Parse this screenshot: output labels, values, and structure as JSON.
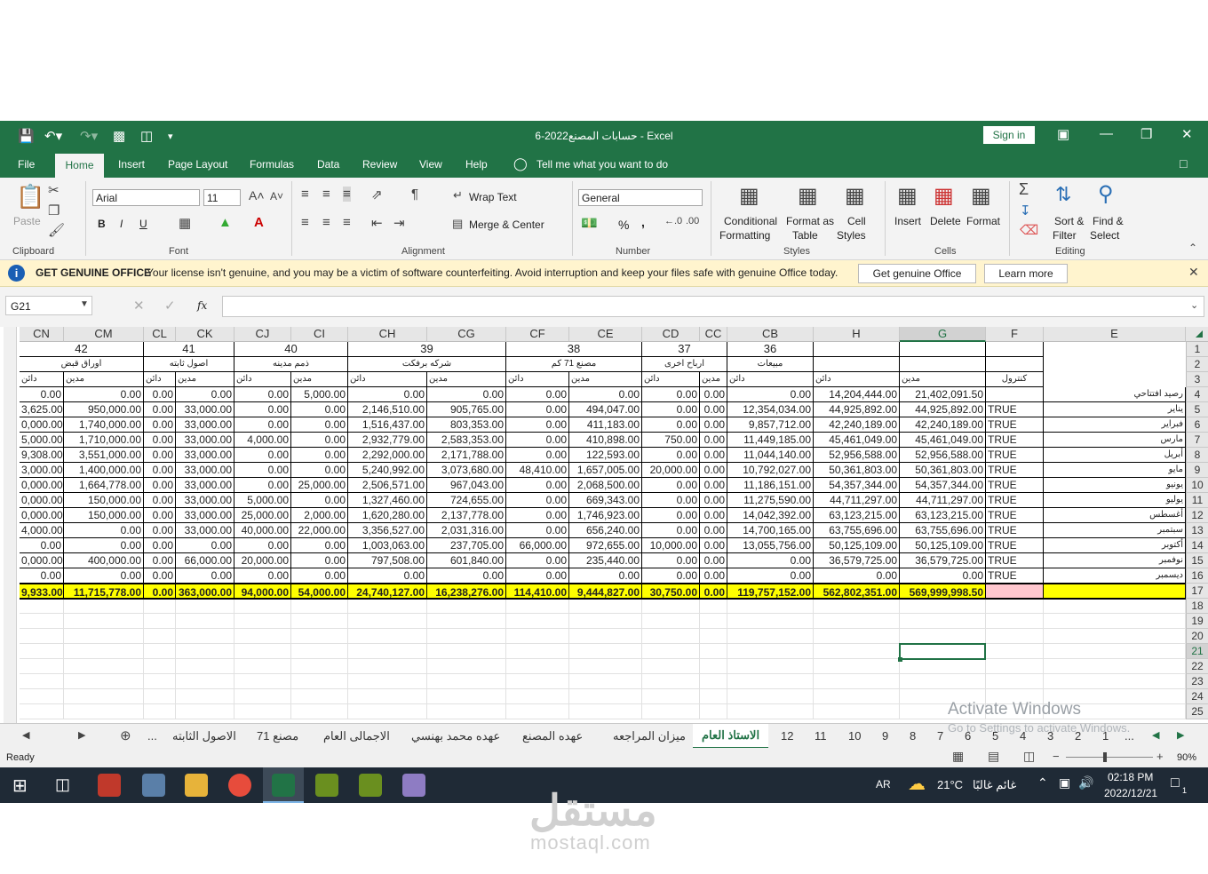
{
  "app": {
    "title": "حسابات المصنع2022-6  -  Excel",
    "sign_in": "Sign in"
  },
  "ribbon_tabs": [
    "File",
    "Home",
    "Insert",
    "Page Layout",
    "Formulas",
    "Data",
    "Review",
    "View",
    "Help"
  ],
  "tell_me": "Tell me what you want to do",
  "ribbon": {
    "clipboard": {
      "label": "Clipboard",
      "paste": "Paste"
    },
    "font": {
      "label": "Font",
      "name": "Arial",
      "size": "11",
      "bold": "B",
      "italic": "I",
      "underline": "U"
    },
    "alignment": {
      "label": "Alignment",
      "wrap": "Wrap Text",
      "merge": "Merge & Center"
    },
    "number": {
      "label": "Number",
      "format": "General",
      "percent": "%",
      "comma": ","
    },
    "styles": {
      "label": "Styles",
      "conditional": "Conditional",
      "formatting": "Formatting",
      "format_as": "Format as",
      "table": "Table",
      "cell": "Cell",
      "cell_styles": "Styles"
    },
    "cells": {
      "label": "Cells",
      "insert": "Insert",
      "delete": "Delete",
      "format": "Format"
    },
    "editing": {
      "label": "Editing",
      "sort": "Sort &",
      "filter": "Filter",
      "find": "Find &",
      "select": "Select"
    }
  },
  "license": {
    "title": "GET GENUINE OFFICE",
    "message": "Your license isn't genuine, and you may be a victim of software counterfeiting. Avoid interruption and keep your files safe with genuine Office today.",
    "button1": "Get genuine Office",
    "button2": "Learn more"
  },
  "formula_bar": {
    "name_box": "G21",
    "fx": "fx",
    "value": ""
  },
  "columns": [
    "CN",
    "CM",
    "CL",
    "CK",
    "CJ",
    "CI",
    "CH",
    "CG",
    "CF",
    "CE",
    "CD",
    "CC",
    "CB",
    "H",
    "G",
    "F",
    "E"
  ],
  "row_numbers": [
    "1",
    "2",
    "3",
    "4",
    "5",
    "6",
    "7",
    "8",
    "9",
    "10",
    "11",
    "12",
    "13",
    "14",
    "15",
    "16",
    "17",
    "18",
    "19",
    "20",
    "21",
    "22",
    "23",
    "24",
    "25"
  ],
  "sheet": {
    "group_numbers": [
      "42",
      "41",
      "40",
      "39",
      "38",
      "37",
      "36"
    ],
    "group_names": [
      "اوراق قبض",
      "اصول ثابته",
      "ذمم مدينه",
      "شركه برفكت",
      "مصنع 71 كم",
      "ارباح اخرى",
      "مبيعات"
    ],
    "dain": "دائن",
    "madin": "مدين",
    "control": "كنترول",
    "rows": [
      {
        "CN": "0.00",
        "CM": "0.00",
        "CL": "0.00",
        "CK": "0.00",
        "CJ": "0.00",
        "CI": "5,000.00",
        "CH": "0.00",
        "CG": "0.00",
        "CF": "0.00",
        "CE": "0.00",
        "CD": "0.00",
        "CC": "0.00",
        "CB": "0.00",
        "H": "14,204,444.00",
        "G": "21,402,091.50",
        "F": "",
        "E": "رصيد افتتاحي"
      },
      {
        "CN": "3,625.00",
        "CM": "950,000.00",
        "CL": "0.00",
        "CK": "33,000.00",
        "CJ": "0.00",
        "CI": "0.00",
        "CH": "2,146,510.00",
        "CG": "905,765.00",
        "CF": "0.00",
        "CE": "494,047.00",
        "CD": "0.00",
        "CC": "0.00",
        "CB": "12,354,034.00",
        "H": "44,925,892.00",
        "G": "44,925,892.00",
        "F": "TRUE",
        "E": "يناير"
      },
      {
        "CN": "0,000.00",
        "CM": "1,740,000.00",
        "CL": "0.00",
        "CK": "33,000.00",
        "CJ": "0.00",
        "CI": "0.00",
        "CH": "1,516,437.00",
        "CG": "803,353.00",
        "CF": "0.00",
        "CE": "411,183.00",
        "CD": "0.00",
        "CC": "0.00",
        "CB": "9,857,712.00",
        "H": "42,240,189.00",
        "G": "42,240,189.00",
        "F": "TRUE",
        "E": "فبراير"
      },
      {
        "CN": "5,000.00",
        "CM": "1,710,000.00",
        "CL": "0.00",
        "CK": "33,000.00",
        "CJ": "4,000.00",
        "CI": "0.00",
        "CH": "2,932,779.00",
        "CG": "2,583,353.00",
        "CF": "0.00",
        "CE": "410,898.00",
        "CD": "750.00",
        "CC": "0.00",
        "CB": "11,449,185.00",
        "H": "45,461,049.00",
        "G": "45,461,049.00",
        "F": "TRUE",
        "E": "مارس"
      },
      {
        "CN": "9,308.00",
        "CM": "3,551,000.00",
        "CL": "0.00",
        "CK": "33,000.00",
        "CJ": "0.00",
        "CI": "0.00",
        "CH": "2,292,000.00",
        "CG": "2,171,788.00",
        "CF": "0.00",
        "CE": "122,593.00",
        "CD": "0.00",
        "CC": "0.00",
        "CB": "11,044,140.00",
        "H": "52,956,588.00",
        "G": "52,956,588.00",
        "F": "TRUE",
        "E": "أبريل"
      },
      {
        "CN": "3,000.00",
        "CM": "1,400,000.00",
        "CL": "0.00",
        "CK": "33,000.00",
        "CJ": "0.00",
        "CI": "0.00",
        "CH": "5,240,992.00",
        "CG": "3,073,680.00",
        "CF": "48,410.00",
        "CE": "1,657,005.00",
        "CD": "20,000.00",
        "CC": "0.00",
        "CB": "10,792,027.00",
        "H": "50,361,803.00",
        "G": "50,361,803.00",
        "F": "TRUE",
        "E": "مايو"
      },
      {
        "CN": "0,000.00",
        "CM": "1,664,778.00",
        "CL": "0.00",
        "CK": "33,000.00",
        "CJ": "0.00",
        "CI": "25,000.00",
        "CH": "2,506,571.00",
        "CG": "967,043.00",
        "CF": "0.00",
        "CE": "2,068,500.00",
        "CD": "0.00",
        "CC": "0.00",
        "CB": "11,186,151.00",
        "H": "54,357,344.00",
        "G": "54,357,344.00",
        "F": "TRUE",
        "E": "يونيو"
      },
      {
        "CN": "0,000.00",
        "CM": "150,000.00",
        "CL": "0.00",
        "CK": "33,000.00",
        "CJ": "5,000.00",
        "CI": "0.00",
        "CH": "1,327,460.00",
        "CG": "724,655.00",
        "CF": "0.00",
        "CE": "669,343.00",
        "CD": "0.00",
        "CC": "0.00",
        "CB": "11,275,590.00",
        "H": "44,711,297.00",
        "G": "44,711,297.00",
        "F": "TRUE",
        "E": "يوليو"
      },
      {
        "CN": "0,000.00",
        "CM": "150,000.00",
        "CL": "0.00",
        "CK": "33,000.00",
        "CJ": "25,000.00",
        "CI": "2,000.00",
        "CH": "1,620,280.00",
        "CG": "2,137,778.00",
        "CF": "0.00",
        "CE": "1,746,923.00",
        "CD": "0.00",
        "CC": "0.00",
        "CB": "14,042,392.00",
        "H": "63,123,215.00",
        "G": "63,123,215.00",
        "F": "TRUE",
        "E": "أغسطس"
      },
      {
        "CN": "4,000.00",
        "CM": "0.00",
        "CL": "0.00",
        "CK": "33,000.00",
        "CJ": "40,000.00",
        "CI": "22,000.00",
        "CH": "3,356,527.00",
        "CG": "2,031,316.00",
        "CF": "0.00",
        "CE": "656,240.00",
        "CD": "0.00",
        "CC": "0.00",
        "CB": "14,700,165.00",
        "H": "63,755,696.00",
        "G": "63,755,696.00",
        "F": "TRUE",
        "E": "سبتمبر"
      },
      {
        "CN": "0.00",
        "CM": "0.00",
        "CL": "0.00",
        "CK": "0.00",
        "CJ": "0.00",
        "CI": "0.00",
        "CH": "1,003,063.00",
        "CG": "237,705.00",
        "CF": "66,000.00",
        "CE": "972,655.00",
        "CD": "10,000.00",
        "CC": "0.00",
        "CB": "13,055,756.00",
        "H": "50,125,109.00",
        "G": "50,125,109.00",
        "F": "TRUE",
        "E": "أكتوبر"
      },
      {
        "CN": "0,000.00",
        "CM": "400,000.00",
        "CL": "0.00",
        "CK": "66,000.00",
        "CJ": "20,000.00",
        "CI": "0.00",
        "CH": "797,508.00",
        "CG": "601,840.00",
        "CF": "0.00",
        "CE": "235,440.00",
        "CD": "0.00",
        "CC": "0.00",
        "CB": "0.00",
        "H": "36,579,725.00",
        "G": "36,579,725.00",
        "F": "TRUE",
        "E": "نوفمبر"
      },
      {
        "CN": "0.00",
        "CM": "0.00",
        "CL": "0.00",
        "CK": "0.00",
        "CJ": "0.00",
        "CI": "0.00",
        "CH": "0.00",
        "CG": "0.00",
        "CF": "0.00",
        "CE": "0.00",
        "CD": "0.00",
        "CC": "0.00",
        "CB": "0.00",
        "H": "0.00",
        "G": "0.00",
        "F": "TRUE",
        "E": "ديسمبر"
      }
    ],
    "totals": {
      "CN": "9,933.00",
      "CM": "11,715,778.00",
      "CL": "0.00",
      "CK": "363,000.00",
      "CJ": "94,000.00",
      "CI": "54,000.00",
      "CH": "24,740,127.00",
      "CG": "16,238,276.00",
      "CF": "114,410.00",
      "CE": "9,444,827.00",
      "CD": "30,750.00",
      "CC": "0.00",
      "CB": "119,757,152.00",
      "H": "562,802,351.00",
      "G": "569,999,998.50",
      "F": "",
      "E": ""
    }
  },
  "sheet_tabs_left": [
    "الاصول الثابته",
    "مصنع 71",
    "الاجمالى العام",
    "عهده محمد بهنسي",
    "عهده المصنع",
    "ميزان المراجعه",
    "الاستاذ العام"
  ],
  "sheet_tabs_right": [
    "12",
    "11",
    "10",
    "9",
    "8",
    "7",
    "6",
    "5",
    "4",
    "3",
    "2",
    "1"
  ],
  "sheet_more": "...",
  "watermark": {
    "line1": "Activate Windows",
    "line2": "Go to Settings to activate Windows."
  },
  "status": {
    "ready": "Ready",
    "zoom": "90%"
  },
  "taskbar": {
    "lang": "AR",
    "temp": "21°C",
    "weather": "غائم غالبًا",
    "time": "02:18 PM",
    "date": "2022/12/21",
    "notifications": "1"
  },
  "site_watermark": {
    "arabic": "مستقل",
    "domain": "mostaql.com"
  },
  "colors": {
    "excel_green": "#217346",
    "total_yellow": "#ffff00",
    "pink": "#ffc7ce",
    "license_bg": "#fff4ce"
  }
}
